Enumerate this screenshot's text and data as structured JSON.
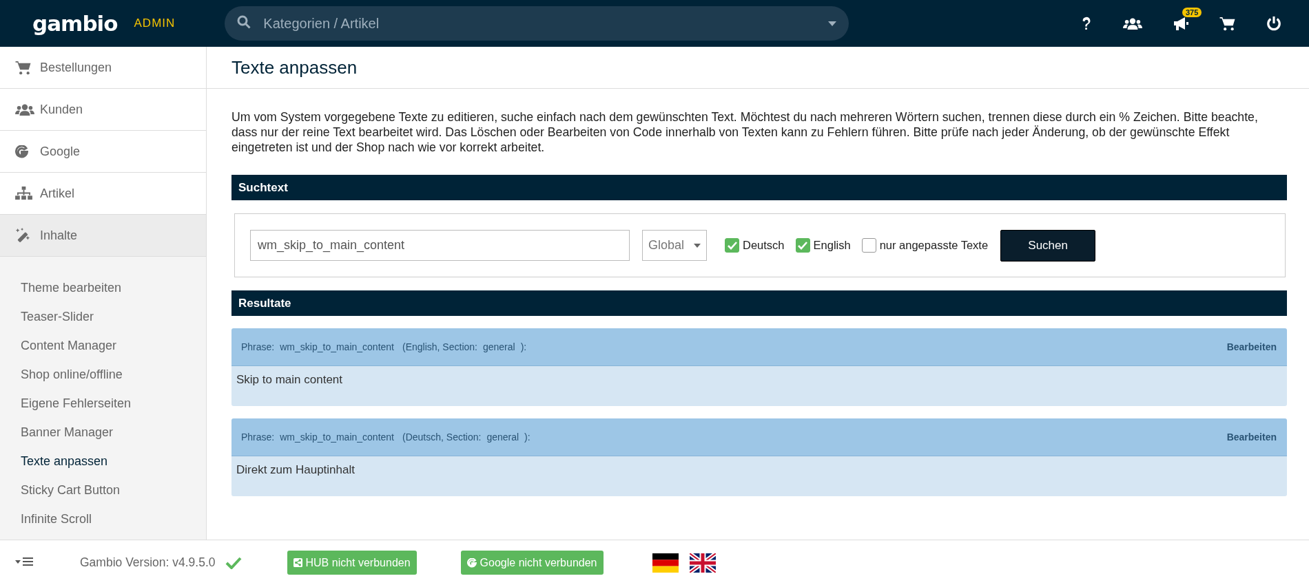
{
  "header": {
    "logo": "gambio",
    "admin": "ADMIN",
    "search": {
      "placeholder": "Kategorien / Artikel"
    },
    "icons": [
      {
        "kind": "help"
      },
      {
        "kind": "users"
      },
      {
        "kind": "megaphone",
        "badge": "375"
      },
      {
        "kind": "cart"
      },
      {
        "kind": "power"
      }
    ]
  },
  "sidebar": {
    "items": [
      {
        "label": "Bestellungen",
        "kind": "cart",
        "selected": false
      },
      {
        "label": "Kunden",
        "kind": "users",
        "selected": false
      },
      {
        "label": "Google",
        "kind": "google",
        "selected": false
      },
      {
        "label": "Artikel",
        "kind": "sitemap",
        "selected": false
      },
      {
        "label": "Inhalte",
        "kind": "magic",
        "selected": true
      }
    ],
    "sub_items": [
      {
        "label": "Theme bearbeiten",
        "selected": false
      },
      {
        "label": "Teaser-Slider",
        "selected": false
      },
      {
        "label": "Content Manager",
        "selected": false
      },
      {
        "label": "Shop online/offline",
        "selected": false
      },
      {
        "label": "Eigene Fehlerseiten",
        "selected": false
      },
      {
        "label": "Banner Manager",
        "selected": false
      },
      {
        "label": "Texte anpassen",
        "selected": true
      },
      {
        "label": "Sticky Cart Button",
        "selected": false
      },
      {
        "label": "Infinite Scroll",
        "selected": false
      }
    ]
  },
  "page_title": "Texte anpassen",
  "intro": "Um vom System vorgegebene Texte zu editieren, suche einfach nach dem gewünschten Text. Möchtest du nach mehreren Wörtern suchen, trennen diese durch ein % Zeichen. Bitte beachte, dass nur der reine Text bearbeitet wird. Das Löschen oder Bearbeiten von Code innerhalb von Texten kann zu Fehlern führen. Bitte prüfe nach jeder Änderung, ob der gewünschte Effekt eingetreten ist und der Shop nach wie vor korrekt arbeitet.",
  "search_section": {
    "title": "Suchtext",
    "field": {
      "value": "wm_skip_to_main_content"
    },
    "select": "Global",
    "checkboxes": [
      {
        "label": "Deutsch",
        "checked": true
      },
      {
        "label": "English",
        "checked": true
      },
      {
        "label": "nur angepasste Texte",
        "checked": false
      }
    ],
    "button": "Suchen"
  },
  "results_section": {
    "title": "Resultate",
    "results": [
      {
        "phrase_label": "Phrase:",
        "phrase": "wm_skip_to_main_content",
        "language": "(English, Section:",
        "section": "general",
        "close": "):",
        "edit": "Bearbeiten",
        "text": "Skip to main content"
      },
      {
        "phrase_label": "Phrase:",
        "phrase": "wm_skip_to_main_content",
        "language": "(Deutsch, Section:",
        "section": "general",
        "close": "):",
        "edit": "Bearbeiten",
        "text": "Direkt zum Hauptinhalt"
      }
    ]
  },
  "footer": {
    "version": "Gambio Version: v4.9.5.0",
    "hub_button": "HUB nicht verbunden",
    "google_button": "Google nicht verbunden",
    "flags": [
      {
        "kind": "de"
      },
      {
        "kind": "gb"
      }
    ]
  }
}
